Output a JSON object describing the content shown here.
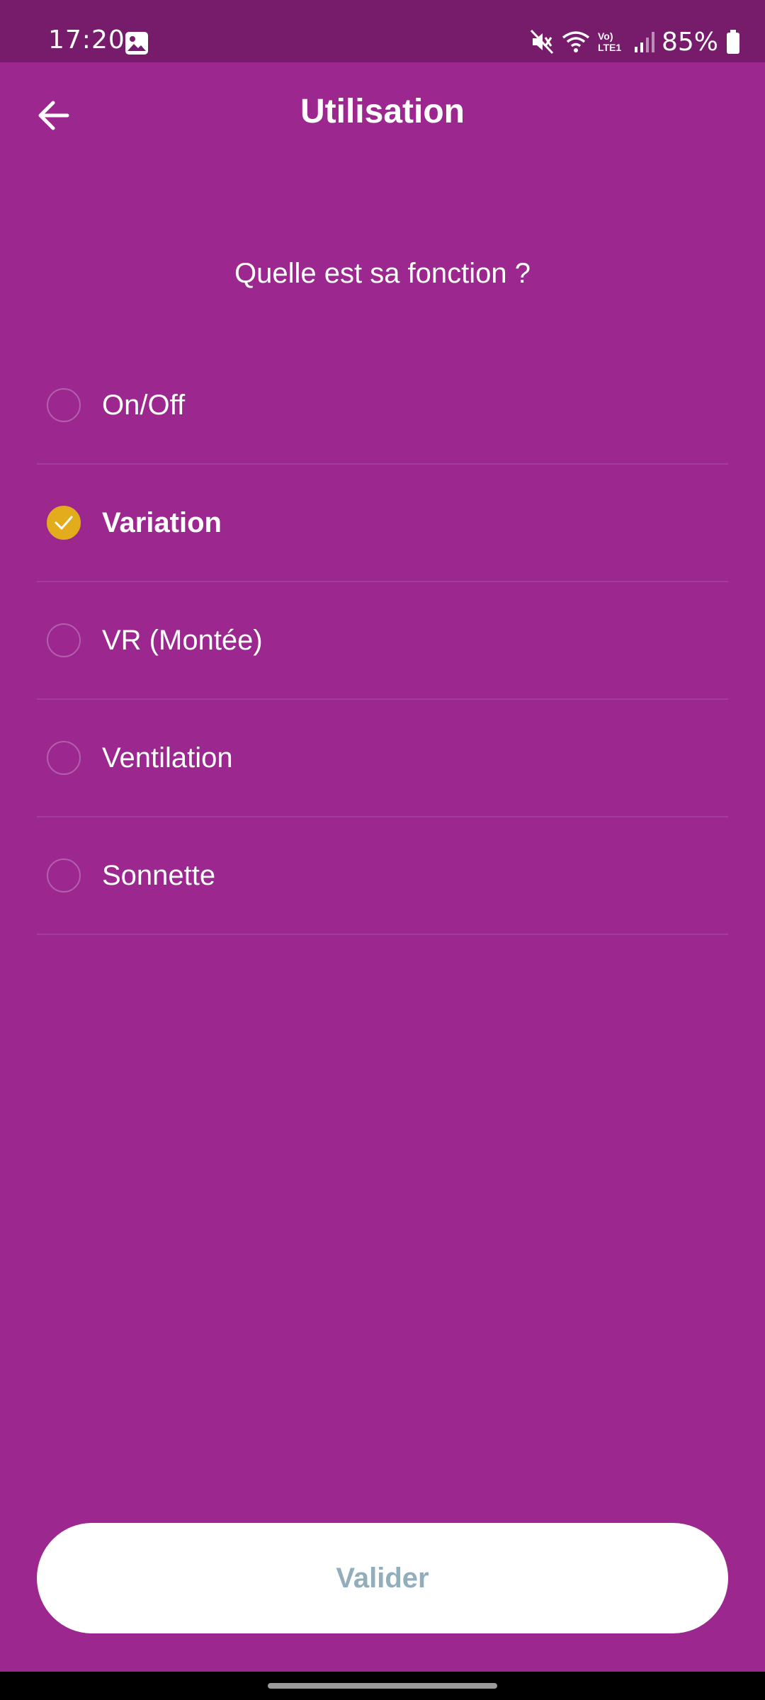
{
  "status_bar": {
    "time": "17:20",
    "battery": "85%",
    "network_label": "Vo) LTE1"
  },
  "header": {
    "title": "Utilisation"
  },
  "question": "Quelle est sa fonction ?",
  "options": [
    {
      "label": "On/Off",
      "selected": false
    },
    {
      "label": "Variation",
      "selected": true
    },
    {
      "label": "VR (Montée)",
      "selected": false
    },
    {
      "label": "Ventilation",
      "selected": false
    },
    {
      "label": "Sonnette",
      "selected": false
    }
  ],
  "validate_button": {
    "label": "Valider"
  },
  "colors": {
    "background": "#9b278f",
    "status_bar": "#761c6b",
    "accent": "#e2ac1d",
    "button_text": "#93aebb"
  },
  "icons": {
    "back": "arrow-left-icon",
    "check": "check-icon",
    "gallery": "image-icon",
    "mute": "mute-icon",
    "wifi": "wifi-icon",
    "signal": "signal-icon",
    "battery": "battery-icon"
  }
}
